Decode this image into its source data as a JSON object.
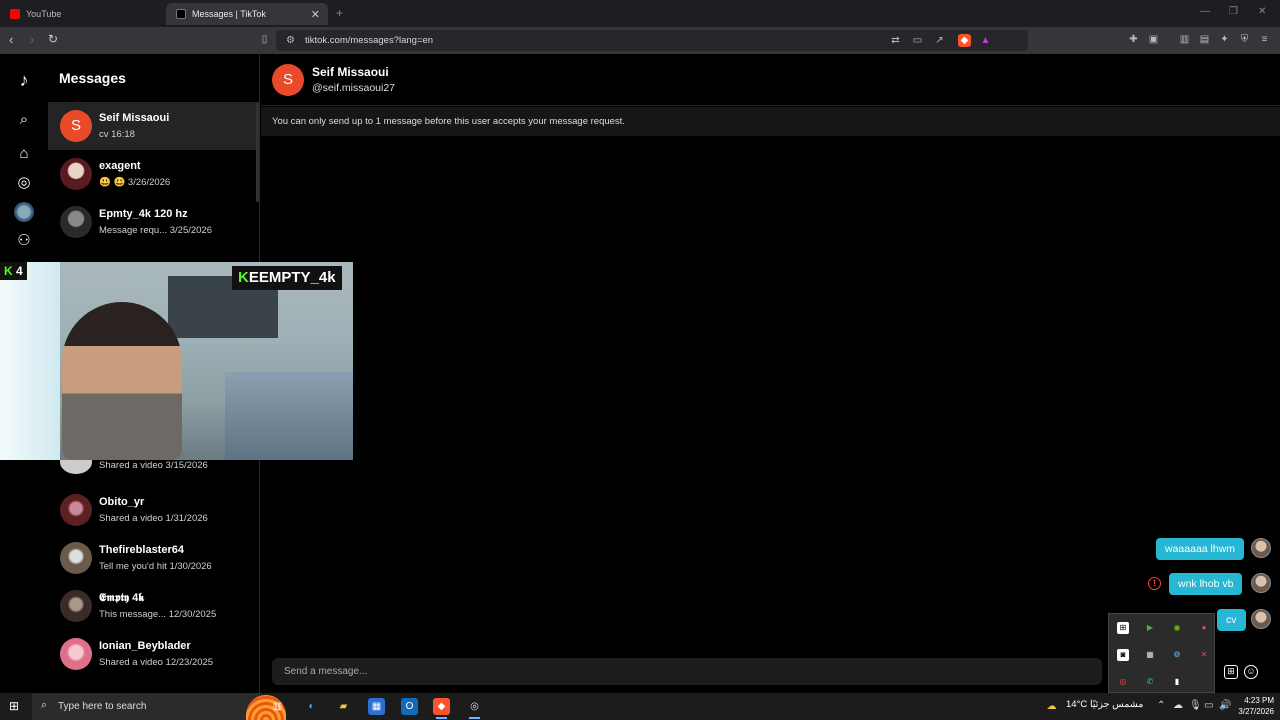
{
  "browser": {
    "tabs": [
      {
        "title": "YouTube",
        "active": false,
        "favicon_color": "#ff0000"
      },
      {
        "title": "Messages | TikTok",
        "active": true,
        "favicon_color": "#000000"
      }
    ],
    "url": "tiktok.com/messages?lang=en"
  },
  "app": {
    "rail_icons": [
      "tiktok-logo",
      "search-icon",
      "home-icon",
      "explore-icon",
      "avatar",
      "friends-icon"
    ],
    "messages_title": "Messages",
    "conversations": [
      {
        "name": "Seif Missaoui",
        "preview": "cv 16:18",
        "active": true,
        "avatar_letter": "S",
        "avatar_color": "#e84a2a"
      },
      {
        "name": "exagent",
        "preview": "😃 😃  3/26/2026",
        "active": false,
        "avatar_color": "#5a1a22"
      },
      {
        "name": "Epmty_4k 120 hz",
        "preview": "Message requ...  3/25/2026",
        "active": false,
        "avatar_color": "#4a4a4a"
      },
      {
        "name": "Shared a video",
        "preview": "Shared a video  3/15/2026",
        "active": false,
        "avatar_color": "#999999"
      },
      {
        "name": "Obito_yr",
        "preview": "Shared a video  1/31/2026",
        "active": false,
        "avatar_color": "#5b2020"
      },
      {
        "name": "Thefireblaster64",
        "preview": "Tell me you'd hit  1/30/2026",
        "active": false,
        "avatar_color": "#6a5a4a"
      },
      {
        "name": "𝕰𝖒𝖕𝖙𝖞 4𝖐",
        "preview": "This message...  12/30/2025",
        "active": false,
        "avatar_color": "#3a2a2a"
      },
      {
        "name": "Ionian_Beyblader",
        "preview": "Shared a video  12/23/2025",
        "active": false,
        "avatar_color": "#e0708a"
      }
    ]
  },
  "chat": {
    "contact_name": "Seif Missaoui",
    "contact_handle": "@seif.missaoui27",
    "contact_initial": "S",
    "notice": "You can only send up to 1 message before this user accepts your message request.",
    "messages": [
      {
        "text": "waaaaaa lhwm",
        "error": false
      },
      {
        "text": "wnk lhob vb",
        "error": true
      },
      {
        "text": "cv",
        "error": false
      }
    ],
    "composer_placeholder": "Send a message..."
  },
  "webcam": {
    "viewer_count": "4",
    "channel_label": "EEMPTY_4k"
  },
  "taskbar": {
    "search_placeholder": "Type here to search",
    "weather_temp": "14°C",
    "weather_text": "مشمس جزئيًا",
    "time": "4:23 PM",
    "date": "3/27/2026"
  }
}
